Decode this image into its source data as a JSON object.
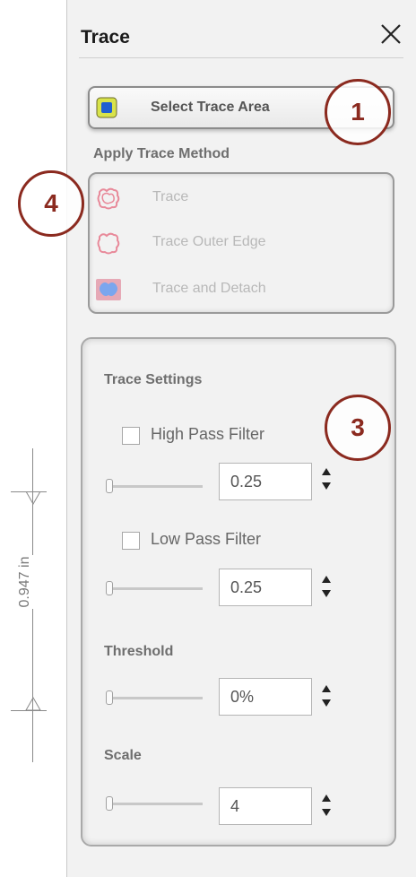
{
  "canvas": {
    "dimension_label": "0.947 in"
  },
  "panel": {
    "title": "Trace",
    "select_trace_area_label": "Select Trace Area",
    "apply_trace_method_label": "Apply Trace Method",
    "methods": [
      {
        "label": "Trace",
        "icon": "trace-icon"
      },
      {
        "label": "Trace Outer Edge",
        "icon": "trace-outer-edge-icon"
      },
      {
        "label": "Trace and Detach",
        "icon": "trace-and-detach-icon"
      }
    ],
    "settings": {
      "heading": "Trace Settings",
      "high_pass": {
        "label": "High Pass Filter",
        "checked": false,
        "value": "0.25"
      },
      "low_pass": {
        "label": "Low Pass Filter",
        "checked": false,
        "value": "0.25"
      },
      "threshold": {
        "label": "Threshold",
        "value": "0%"
      },
      "scale": {
        "label": "Scale",
        "value": "4"
      }
    }
  },
  "annotations": {
    "one": "1",
    "three": "3",
    "four": "4"
  },
  "colors": {
    "annotation": "#8b2a1f",
    "method_icon": "#e88a9a",
    "select_icon": "#1f5fd1"
  }
}
